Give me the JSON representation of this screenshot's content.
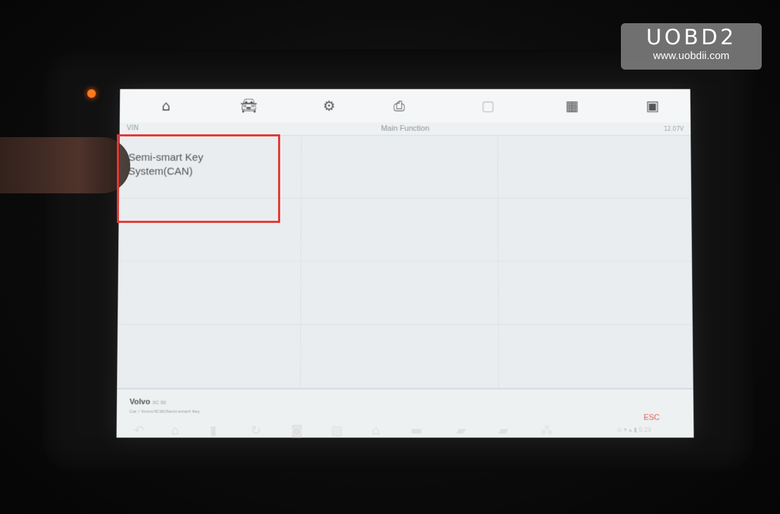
{
  "watermark": {
    "title": "UOBD2",
    "url": "www.uobdii.com"
  },
  "toolbar": {
    "icons": [
      "home-icon",
      "vehicle-icon",
      "settings-icon",
      "print-icon",
      "help-icon",
      "data-logging-icon",
      "screenshot-icon"
    ]
  },
  "subheader": {
    "left": "VIN",
    "title": "Main Function",
    "right": "12.07V"
  },
  "main": {
    "items": [
      {
        "label": "Semi-smart Key System(CAN)"
      }
    ]
  },
  "footer": {
    "vehicle": "Volvo",
    "vehicle_model": "XC 90",
    "path": "Car / Volvo/XC90/Semi-smart Key",
    "esc_label": "ESC"
  },
  "navbar": {
    "icons": [
      "back-icon",
      "home-icon",
      "recent-apps-icon",
      "refresh-icon",
      "camera-icon",
      "image-icon",
      "home-icon",
      "vci-icon",
      "car-icon",
      "car-icon",
      "network-icon"
    ],
    "status": "⊙ ▾ ▴ ▮ 5:29"
  },
  "colors": {
    "highlight": "#e53935",
    "esc": "#e05a4a",
    "led": "#ff7a1a"
  }
}
